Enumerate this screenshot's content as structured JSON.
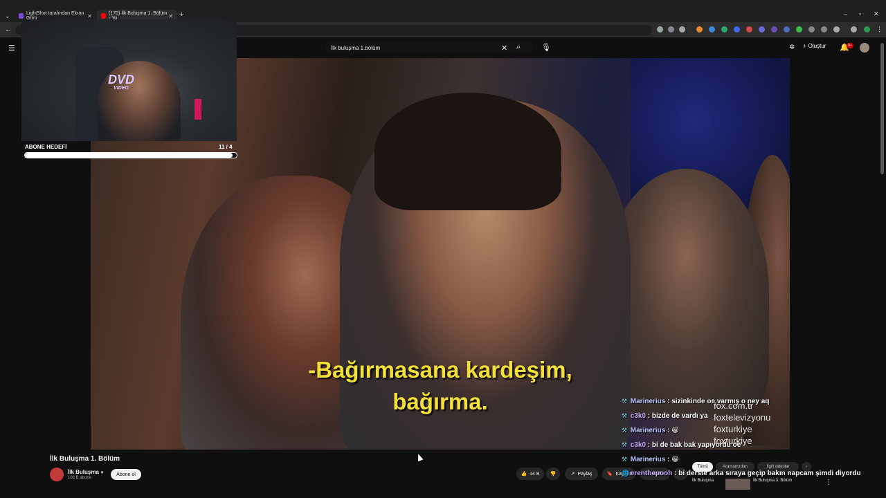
{
  "browser": {
    "tabs": [
      {
        "title": "LightShot tarafından Ekran Görü",
        "active": false
      },
      {
        "title": "(170) İlk Buluşma 1. Bölüm - Yo",
        "active": true
      }
    ],
    "new_tab": "+",
    "window_controls": [
      "–",
      "▫",
      "✕"
    ]
  },
  "youtube": {
    "search_query": "İlk buluşma 1.bölüm",
    "create_label": "Oluştur",
    "notification_count": "9+"
  },
  "overlay": {
    "goal_label": "ABONE HEDEFİ",
    "goal_count": "11 / 4",
    "goal_progress": 0.98,
    "dvd_main": "DVD",
    "dvd_sub": "VIDEO"
  },
  "video": {
    "subtitle_line1": "-Bağırmasana kardeşim,",
    "subtitle_line2": "bağırma.",
    "watermark": [
      "fox.com.tr",
      "foxtelevizyonu",
      "foxturkiye",
      "foxturkiye"
    ]
  },
  "below_video": {
    "title": "İlk Buluşma 1. Bölüm",
    "channel_name": "İlk Buluşma",
    "channel_subs": "106 B abone",
    "subscribe_label": "Abone ol",
    "like_count": "14 B",
    "share_label": "Paylaş",
    "save_label": "Kaydet",
    "download_label": "İndir",
    "chips": [
      "Tümü",
      "Aramanızdan",
      "İlgili videolar"
    ],
    "rec_channel": "İlk Buluşma",
    "rec_title": "İlk Buluşma 3. Bölüm"
  },
  "chat": [
    {
      "user": "Marinerius",
      "text": "sizinkinde oe varmış o ney aq"
    },
    {
      "user": "c3k0",
      "text": "bizde de vardı ya"
    },
    {
      "user": "Marinerius",
      "text": "😀"
    },
    {
      "user": "c3k0",
      "text": "bi de bak bak yapıyordu oe"
    },
    {
      "user": "Marinerius",
      "text": "😀"
    },
    {
      "user": "erenthepooh",
      "text": "bi derste arka sıraya geçip bakın napcam şimdi diyordu"
    }
  ]
}
